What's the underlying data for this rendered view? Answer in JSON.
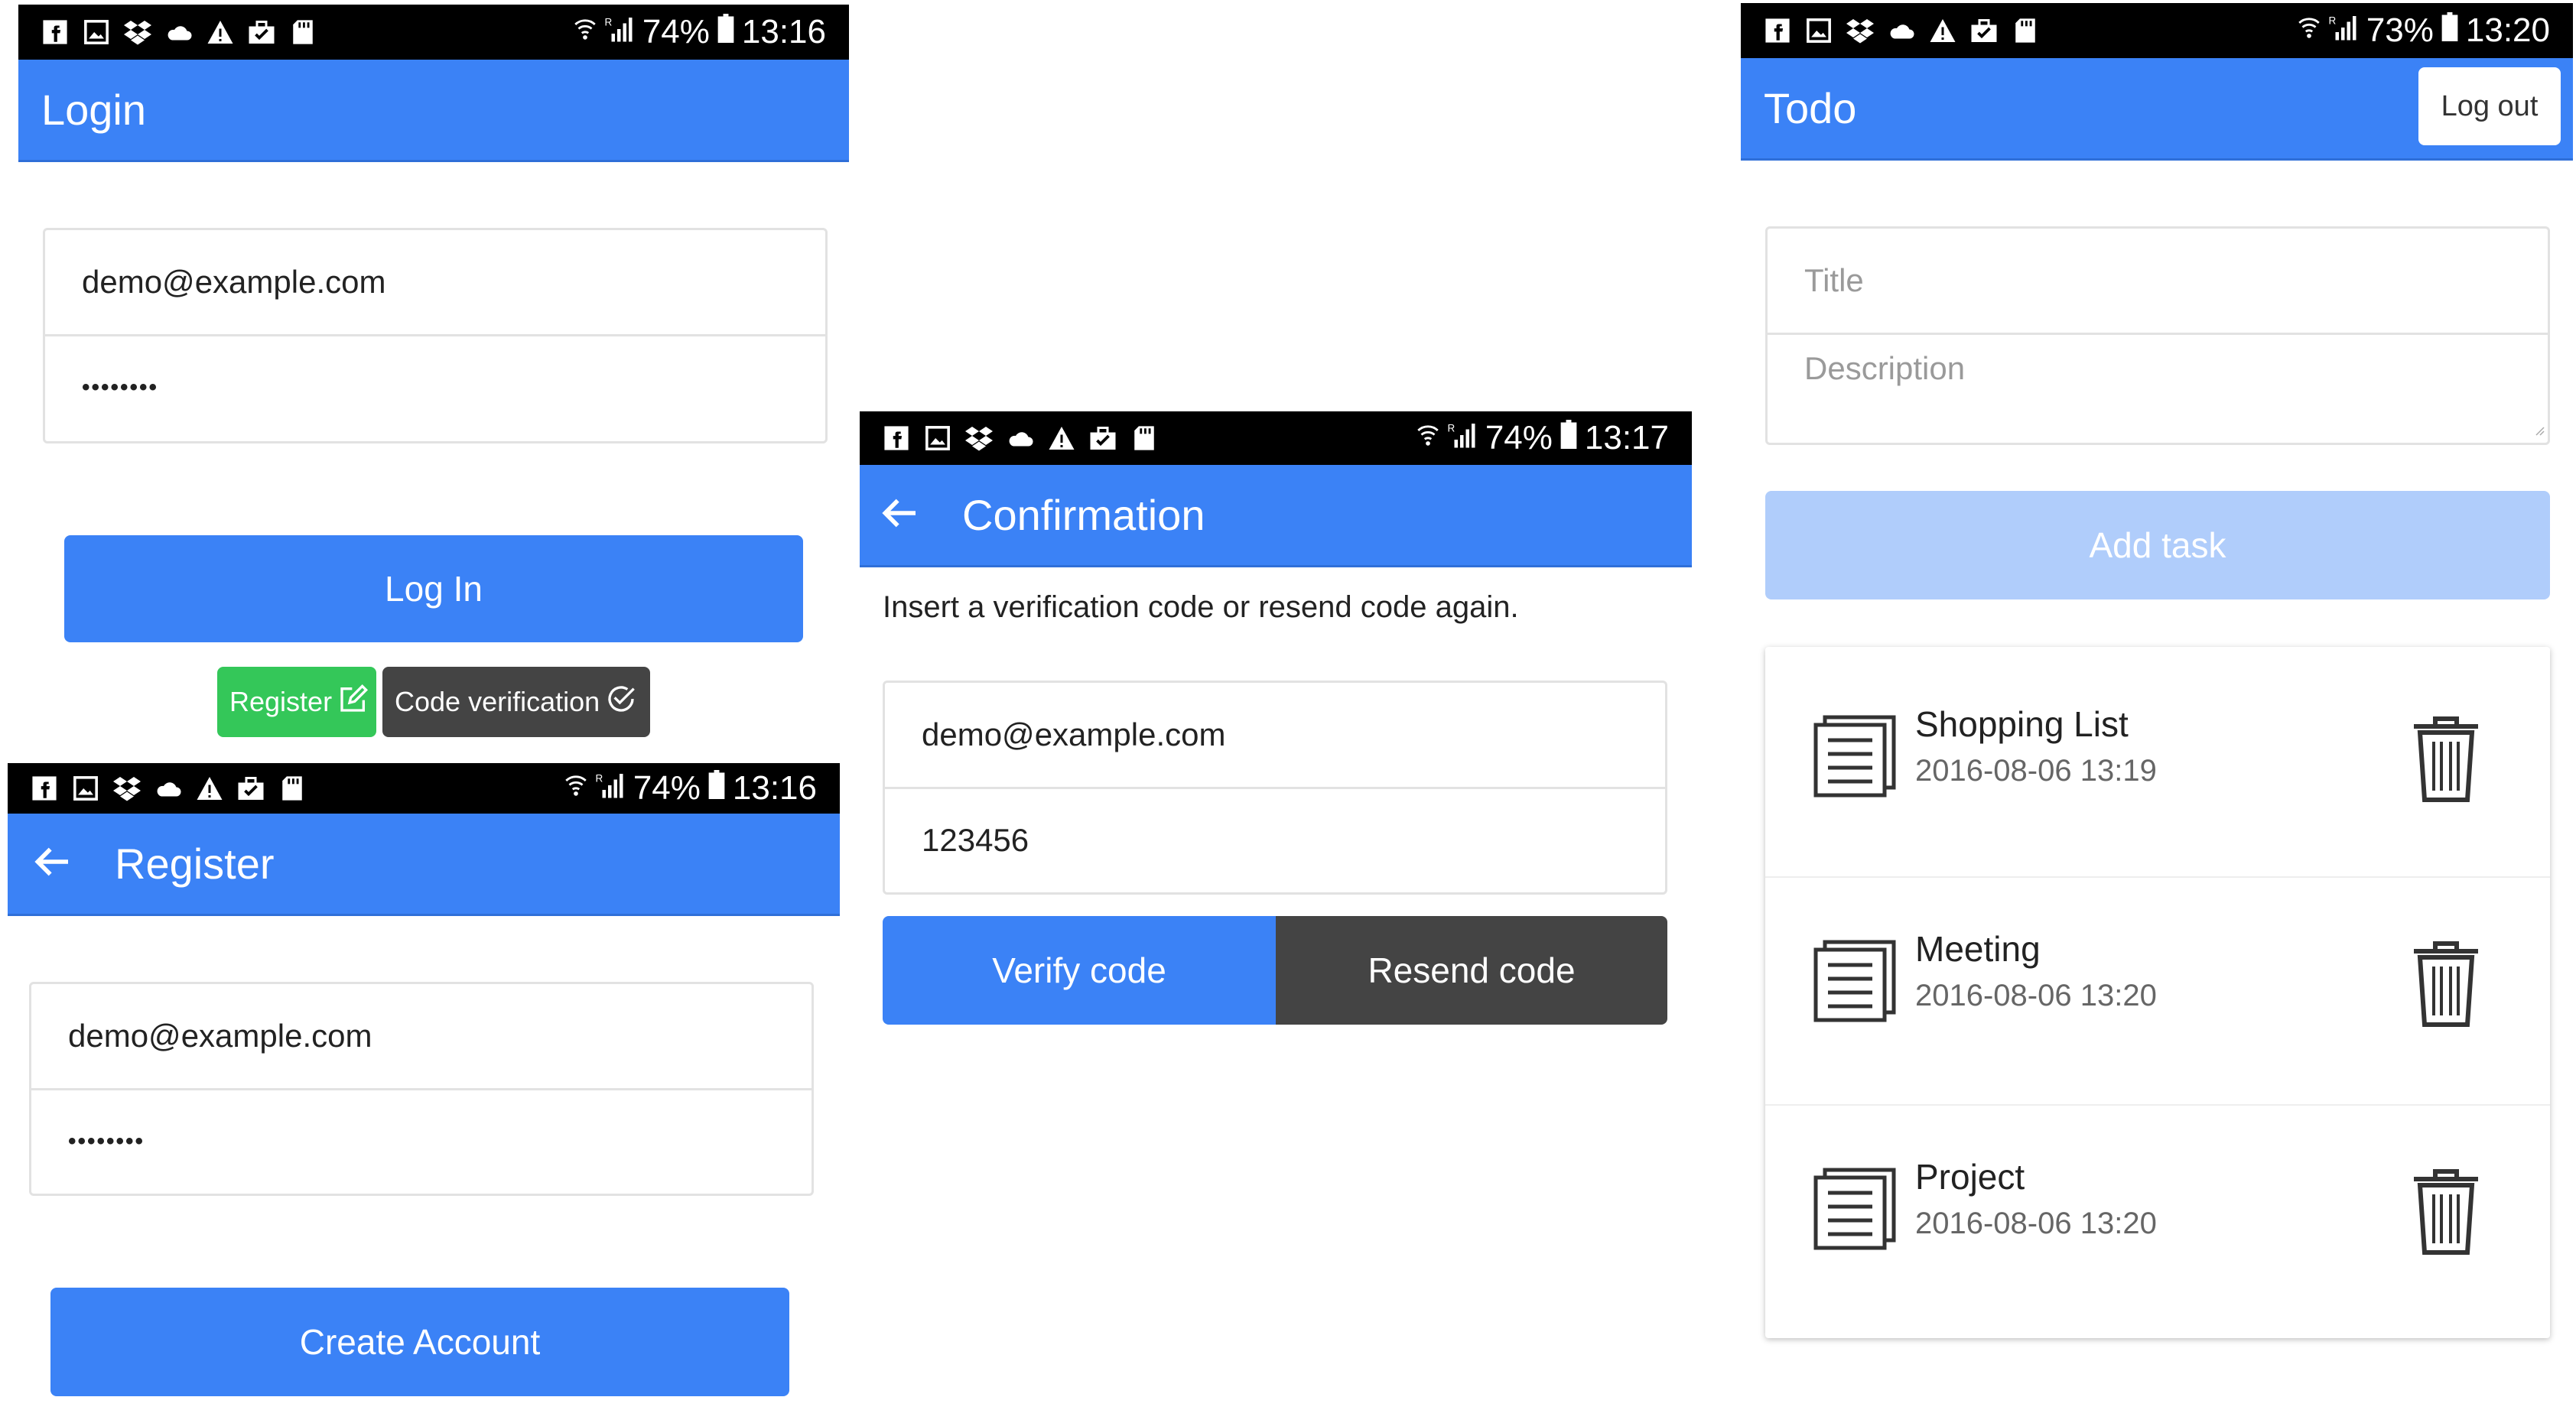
{
  "login": {
    "status": {
      "battery": "74%",
      "time": "13:16"
    },
    "title": "Login",
    "email": "demo@example.com",
    "password": "••••••••",
    "login_button": "Log In",
    "register_chip": "Register",
    "code_chip": "Code verification",
    "colors": {
      "register": "#34c759",
      "code": "#444444"
    }
  },
  "register": {
    "status": {
      "battery": "74%",
      "time": "13:16"
    },
    "title": "Register",
    "email": "demo@example.com",
    "password": "••••••••",
    "create_button": "Create Account"
  },
  "confirmation": {
    "status": {
      "battery": "74%",
      "time": "13:17"
    },
    "title": "Confirmation",
    "instruction": "Insert a verification code or resend code again.",
    "email": "demo@example.com",
    "code": "123456",
    "verify_button": "Verify code",
    "resend_button": "Resend code"
  },
  "todo": {
    "status": {
      "battery": "73%",
      "time": "13:20"
    },
    "title": "Todo",
    "logout_button": "Log out",
    "title_placeholder": "Title",
    "description_placeholder": "Description",
    "add_button": "Add task",
    "items": [
      {
        "title": "Shopping List",
        "date": "2016-08-06 13:19"
      },
      {
        "title": "Meeting",
        "date": "2016-08-06 13:20"
      },
      {
        "title": "Project",
        "date": "2016-08-06 13:20"
      }
    ]
  },
  "colors": {
    "accent": "#3b82f6",
    "statusbar": "#000000",
    "disabled_button": "#b0cdfb"
  },
  "status_icons": [
    "facebook-icon",
    "gallery-icon",
    "dropbox-icon",
    "cloud-icon",
    "warning-icon",
    "briefcase-icon",
    "sdcard-icon"
  ]
}
